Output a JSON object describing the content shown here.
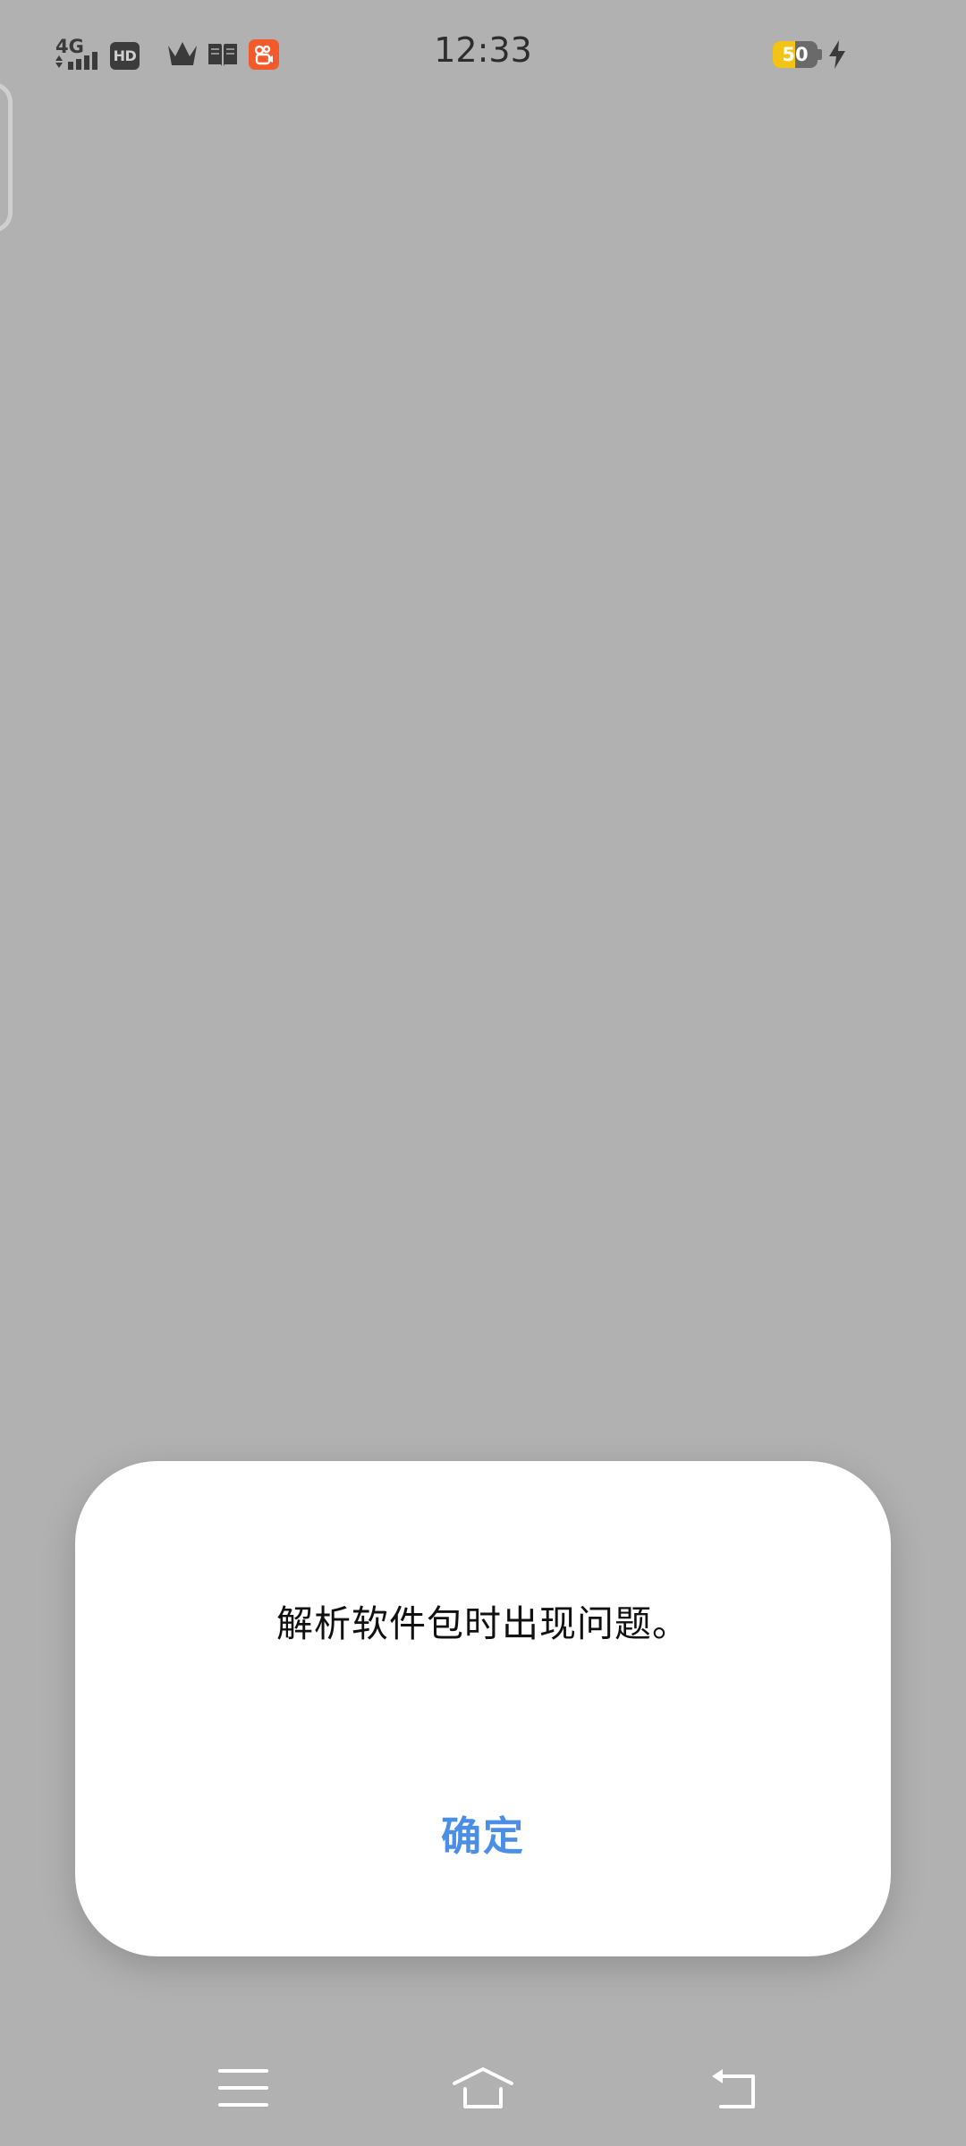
{
  "status_bar": {
    "network_type": "4G",
    "hd_label": "HD",
    "time": "12:33",
    "battery_level": "50",
    "battery_fraction": 0.5,
    "icons": [
      "signal-icon",
      "hd-icon",
      "crown-icon",
      "book-icon",
      "app-icon",
      "battery-icon",
      "charging-bolt-icon"
    ]
  },
  "dialog": {
    "message": "解析软件包时出现问题。",
    "confirm_label": "确定",
    "accent_color": "#4a8ee6"
  },
  "nav_bar": {
    "icons": [
      "menu-icon",
      "home-icon",
      "back-icon"
    ]
  }
}
